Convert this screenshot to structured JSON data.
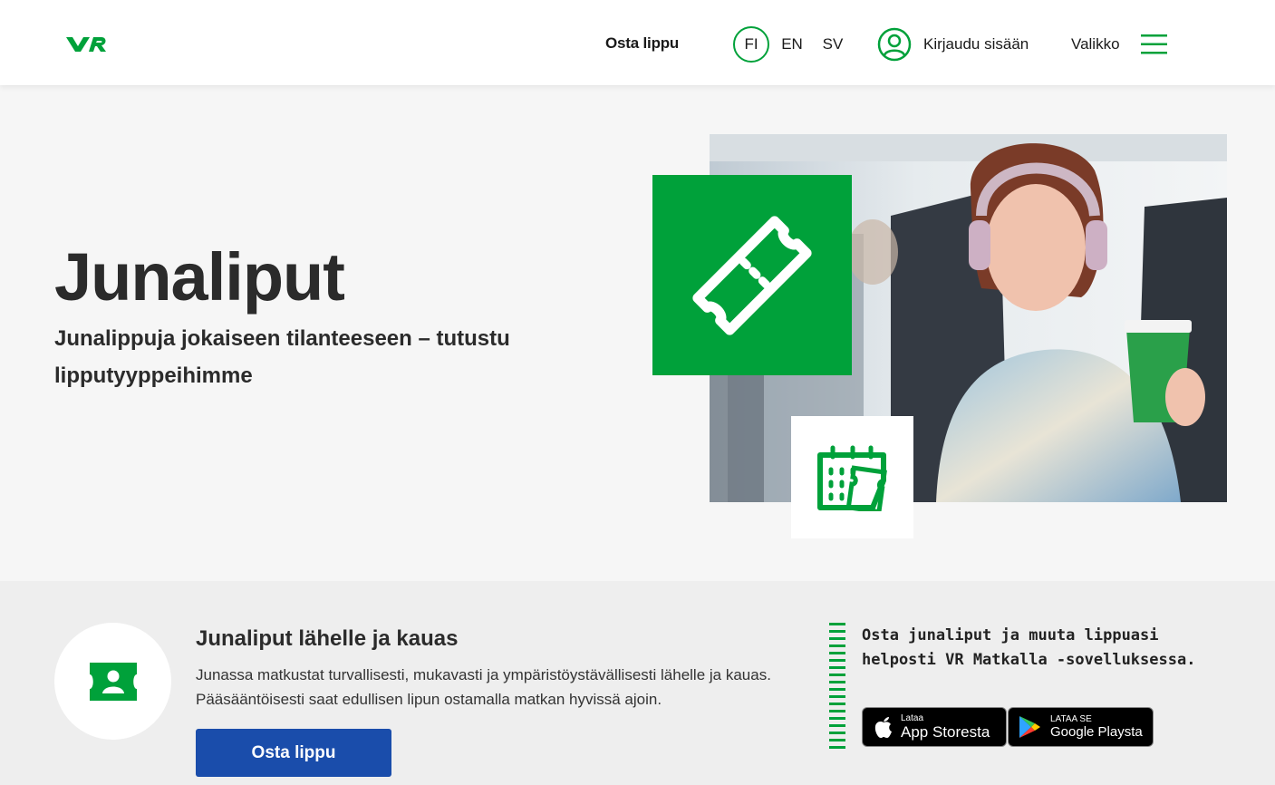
{
  "header": {
    "logo_text": "VR",
    "buy_label": "Osta lippu",
    "languages": [
      "FI",
      "EN",
      "SV"
    ],
    "active_language": "FI",
    "login_label": "Kirjaudu sisään",
    "menu_label": "Valikko"
  },
  "hero": {
    "title": "Junaliput",
    "subtitle": "Junalippuja jokaiseen tilanteeseen – tutustu lipputyyppeihimme"
  },
  "lower": {
    "title": "Junaliput lähelle ja kauas",
    "body": "Junassa matkustat turvallisesti, mukavasti ja ympäristöystävällisesti lähelle ja kauas. Pääsääntöisesti saat edullisen lipun ostamalla matkan hyvissä ajoin.",
    "cta_label": "Osta lippu",
    "promo_text": "Osta junaliput ja muuta lippuasi helposti VR Matkalla -sovelluksessa.",
    "app_store": {
      "small": "Lataa",
      "big": "App Storesta"
    },
    "google_play": {
      "small": "LATAA SE",
      "big": "Google Playsta"
    }
  },
  "colors": {
    "brand_green": "#00a13a",
    "cta_blue": "#1a4dab",
    "hero_bg": "#f6f6f6",
    "lower_bg": "#eeeeee"
  }
}
